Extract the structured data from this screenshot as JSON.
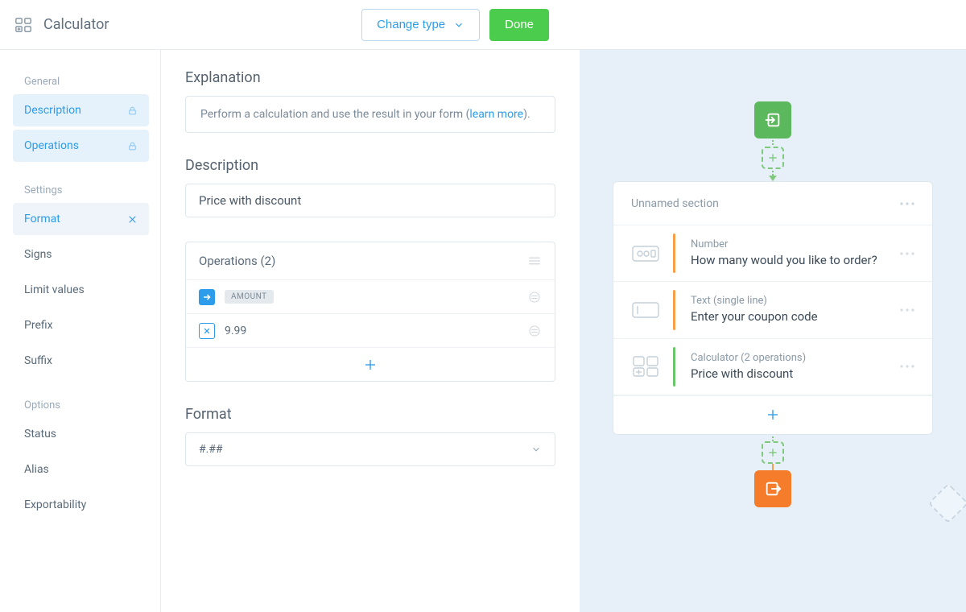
{
  "header": {
    "title": "Calculator",
    "change_type": "Change type",
    "done": "Done"
  },
  "sidebar": {
    "groups": {
      "general": "General",
      "settings": "Settings",
      "options": "Options"
    },
    "items": {
      "description": "Description",
      "operations": "Operations",
      "format": "Format",
      "signs": "Signs",
      "limit_values": "Limit values",
      "prefix": "Prefix",
      "suffix": "Suffix",
      "status": "Status",
      "alias": "Alias",
      "exportability": "Exportability"
    }
  },
  "main": {
    "explanation_label": "Explanation",
    "explanation_text_pre": "Perform a calculation and use the result in your form (",
    "explanation_link": "learn more",
    "explanation_text_post": ").",
    "description_label": "Description",
    "description_value": "Price with discount",
    "operations_label": "Operations (2)",
    "op1_chip": "AMOUNT",
    "op2_value": "9.99",
    "format_label": "Format",
    "format_value": "#.##"
  },
  "preview": {
    "section_title": "Unnamed section",
    "fields": {
      "f1_type": "Number",
      "f1_label": "How many would you like to order?",
      "f2_type": "Text (single line)",
      "f2_label": "Enter your coupon code",
      "f3_type": "Calculator (2 operations)",
      "f3_label": "Price with discount"
    }
  }
}
